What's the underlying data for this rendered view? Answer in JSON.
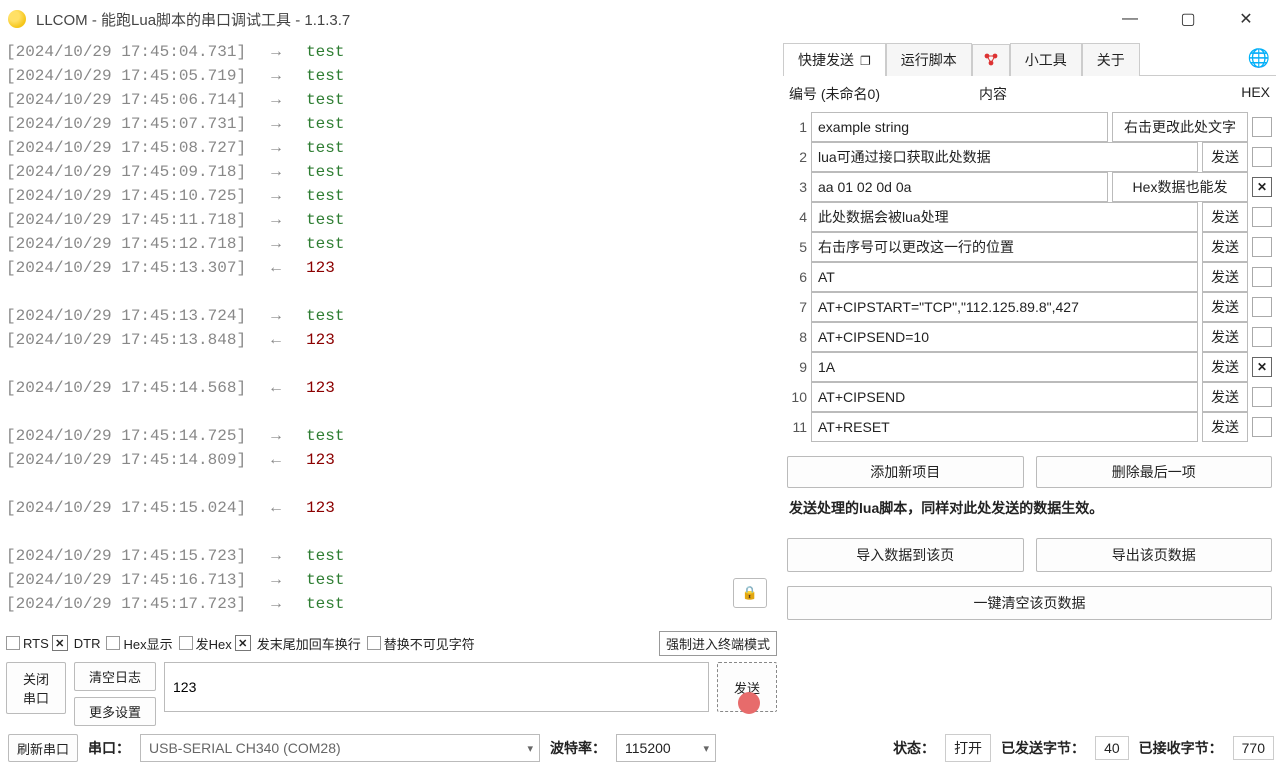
{
  "titlebar": {
    "title": "LLCOM - 能跑Lua脚本的串口调试工具 - 1.1.3.7"
  },
  "log": [
    {
      "ts": "[2024/10/29 17:45:04.731]",
      "dir": "→",
      "txt": "test",
      "cls": "green"
    },
    {
      "ts": "[2024/10/29 17:45:05.719]",
      "dir": "→",
      "txt": "test",
      "cls": "green"
    },
    {
      "ts": "[2024/10/29 17:45:06.714]",
      "dir": "→",
      "txt": "test",
      "cls": "green"
    },
    {
      "ts": "[2024/10/29 17:45:07.731]",
      "dir": "→",
      "txt": "test",
      "cls": "green"
    },
    {
      "ts": "[2024/10/29 17:45:08.727]",
      "dir": "→",
      "txt": "test",
      "cls": "green"
    },
    {
      "ts": "[2024/10/29 17:45:09.718]",
      "dir": "→",
      "txt": "test",
      "cls": "green"
    },
    {
      "ts": "[2024/10/29 17:45:10.725]",
      "dir": "→",
      "txt": "test",
      "cls": "green"
    },
    {
      "ts": "[2024/10/29 17:45:11.718]",
      "dir": "→",
      "txt": "test",
      "cls": "green"
    },
    {
      "ts": "[2024/10/29 17:45:12.718]",
      "dir": "→",
      "txt": "test",
      "cls": "green"
    },
    {
      "ts": "[2024/10/29 17:45:13.307]",
      "dir": "←",
      "txt": "123",
      "cls": "red"
    },
    {
      "blank": true
    },
    {
      "ts": "[2024/10/29 17:45:13.724]",
      "dir": "→",
      "txt": "test",
      "cls": "green"
    },
    {
      "ts": "[2024/10/29 17:45:13.848]",
      "dir": "←",
      "txt": "123",
      "cls": "red"
    },
    {
      "blank": true
    },
    {
      "ts": "[2024/10/29 17:45:14.568]",
      "dir": "←",
      "txt": "123",
      "cls": "red"
    },
    {
      "blank": true
    },
    {
      "ts": "[2024/10/29 17:45:14.725]",
      "dir": "→",
      "txt": "test",
      "cls": "green"
    },
    {
      "ts": "[2024/10/29 17:45:14.809]",
      "dir": "←",
      "txt": "123",
      "cls": "red"
    },
    {
      "blank": true
    },
    {
      "ts": "[2024/10/29 17:45:15.024]",
      "dir": "←",
      "txt": "123",
      "cls": "red"
    },
    {
      "blank": true
    },
    {
      "ts": "[2024/10/29 17:45:15.723]",
      "dir": "→",
      "txt": "test",
      "cls": "green"
    },
    {
      "ts": "[2024/10/29 17:45:16.713]",
      "dir": "→",
      "txt": "test",
      "cls": "green"
    },
    {
      "ts": "[2024/10/29 17:45:17.723]",
      "dir": "→",
      "txt": "test",
      "cls": "green"
    }
  ],
  "options": {
    "rts": "RTS",
    "dtr": "DTR",
    "hexshow": "Hex显示",
    "sendhex": "发Hex",
    "crlf": "发末尾加回车换行",
    "replace": "替换不可见字符",
    "terminal": "强制进入终端模式"
  },
  "sendarea": {
    "close_port": "关闭\n串口",
    "clear": "清空日志",
    "more": "更多设置",
    "input": "123",
    "send": "发送"
  },
  "tabs": {
    "quick": "快捷发送",
    "run": "运行脚本",
    "tools": "小工具",
    "about": "关于"
  },
  "panel": {
    "hdr_num": "编号 (未命名0)",
    "hdr_content": "内容",
    "hdr_hex": "HEX",
    "rows": [
      {
        "n": "1",
        "content": "example string",
        "btn": "右击更改此处文字",
        "hex": false
      },
      {
        "n": "2",
        "content": "lua可通过接口获取此处数据",
        "btn": "发送",
        "hex": false
      },
      {
        "n": "3",
        "content": "aa 01 02 0d 0a",
        "btn": "Hex数据也能发",
        "hex": true
      },
      {
        "n": "4",
        "content": "此处数据会被lua处理",
        "btn": "发送",
        "hex": false
      },
      {
        "n": "5",
        "content": "右击序号可以更改这一行的位置",
        "btn": "发送",
        "hex": false
      },
      {
        "n": "6",
        "content": "AT",
        "btn": "发送",
        "hex": false
      },
      {
        "n": "7",
        "content": "AT+CIPSTART=\"TCP\",\"112.125.89.8\",427",
        "btn": "发送",
        "hex": false
      },
      {
        "n": "8",
        "content": "AT+CIPSEND=10",
        "btn": "发送",
        "hex": false
      },
      {
        "n": "9",
        "content": "1A",
        "btn": "发送",
        "hex": true
      },
      {
        "n": "10",
        "content": "AT+CIPSEND",
        "btn": "发送",
        "hex": false
      },
      {
        "n": "11",
        "content": "AT+RESET",
        "btn": "发送",
        "hex": false
      }
    ],
    "add": "添加新项目",
    "del": "删除最后一项",
    "note": "发送处理的lua脚本，同样对此处发送的数据生效。",
    "import": "导入数据到该页",
    "export": "导出该页数据",
    "clearall": "一键清空该页数据"
  },
  "status": {
    "refresh": "刷新串口",
    "port_label": "串口：",
    "port": "USB-SERIAL CH340 (COM28)",
    "baud_label": "波特率：",
    "baud": "115200",
    "state_label": "状态：",
    "state": "打开",
    "sent_label": "已发送字节：",
    "sent": "40",
    "recv_label": "已接收字节：",
    "recv": "770"
  }
}
